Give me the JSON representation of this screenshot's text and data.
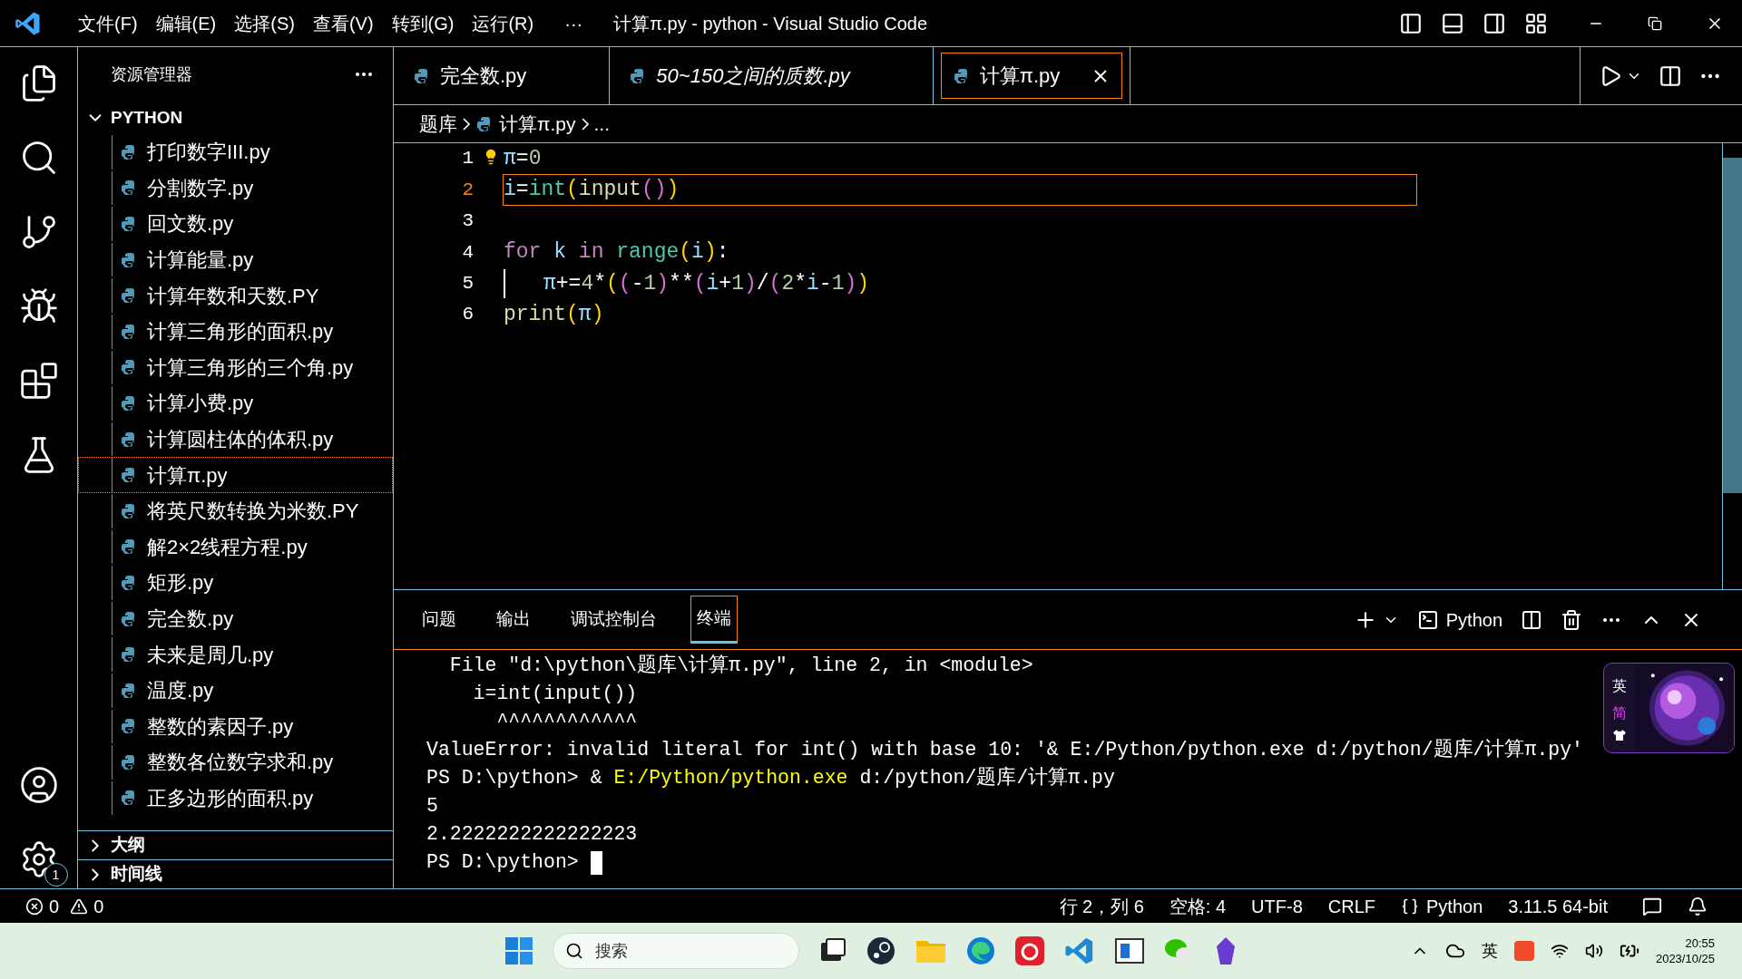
{
  "title_bar": {
    "menus": [
      "文件(F)",
      "编辑(E)",
      "选择(S)",
      "查看(V)",
      "转到(G)",
      "运行(R)"
    ],
    "overflow": "···",
    "title": "计算π.py - python - Visual Studio Code"
  },
  "activity_bar": {
    "settings_badge": "1"
  },
  "sidebar": {
    "title": "资源管理器",
    "folder": {
      "name": "PYTHON",
      "expanded": true
    },
    "files": [
      {
        "name": "打印数字III.py",
        "selected": false
      },
      {
        "name": "分割数字.py",
        "selected": false
      },
      {
        "name": "回文数.py",
        "selected": false
      },
      {
        "name": "计算能量.py",
        "selected": false
      },
      {
        "name": "计算年数和天数.PY",
        "selected": false
      },
      {
        "name": "计算三角形的面积.py",
        "selected": false
      },
      {
        "name": "计算三角形的三个角.py",
        "selected": false
      },
      {
        "name": "计算小费.py",
        "selected": false
      },
      {
        "name": "计算圆柱体的体积.py",
        "selected": false
      },
      {
        "name": "计算π.py",
        "selected": true
      },
      {
        "name": "将英尺数转换为米数.PY",
        "selected": false
      },
      {
        "name": "解2×2线程方程.py",
        "selected": false
      },
      {
        "name": "矩形.py",
        "selected": false
      },
      {
        "name": "完全数.py",
        "selected": false
      },
      {
        "name": "未来是周几.py",
        "selected": false
      },
      {
        "name": "温度.py",
        "selected": false
      },
      {
        "name": "整数的素因子.py",
        "selected": false
      },
      {
        "name": "整数各位数字求和.py",
        "selected": false
      },
      {
        "name": "正多边形的面积.py",
        "selected": false
      }
    ],
    "sections": [
      {
        "name": "大纲",
        "expanded": false
      },
      {
        "name": "时间线",
        "expanded": false
      }
    ]
  },
  "tabs": [
    {
      "label": "完全数.py",
      "selected": false,
      "preview": false
    },
    {
      "label": "50~150之间的质数.py",
      "selected": false,
      "preview": true
    },
    {
      "label": "计算π.py",
      "selected": true,
      "preview": false
    }
  ],
  "breadcrumb": [
    "题库",
    "计算π.py",
    "..."
  ],
  "editor": {
    "lines": [
      {
        "number": "1",
        "current": false,
        "indented": false,
        "tokens": [
          {
            "text": "π",
            "kind": "var"
          },
          {
            "text": "=",
            "kind": "op"
          },
          {
            "text": "0",
            "kind": "num"
          }
        ]
      },
      {
        "number": "2",
        "current": true,
        "indented": false,
        "tokens": [
          {
            "text": "i",
            "kind": "var"
          },
          {
            "text": "=",
            "kind": "op"
          },
          {
            "text": "int",
            "kind": "class"
          },
          {
            "text": "(",
            "kind": "b1"
          },
          {
            "text": "input",
            "kind": "func"
          },
          {
            "text": "()",
            "kind": "b2"
          },
          {
            "text": ")",
            "kind": "b1"
          }
        ]
      },
      {
        "number": "3",
        "current": false,
        "indented": false
      },
      {
        "number": "4",
        "current": false,
        "indented": false,
        "tokens": [
          {
            "text": "for",
            "kind": "keyword"
          },
          {
            "text": " k ",
            "kind": "var"
          },
          {
            "text": "in",
            "kind": "keyword"
          },
          {
            "text": " range",
            "kind": "class"
          },
          {
            "text": "(",
            "kind": "b1"
          },
          {
            "text": "i",
            "kind": "var"
          },
          {
            "text": ")",
            "kind": "b1"
          },
          {
            "text": ":",
            "kind": "op"
          }
        ]
      },
      {
        "number": "5",
        "current": false,
        "indented": true,
        "tokens": [
          {
            "text": "π",
            "kind": "var"
          },
          {
            "text": "+=",
            "kind": "op"
          },
          {
            "text": "4",
            "kind": "num"
          },
          {
            "text": "*",
            "kind": "op"
          },
          {
            "text": "(",
            "kind": "b1"
          },
          {
            "text": "(",
            "kind": "b2"
          },
          {
            "text": "-",
            "kind": "op"
          },
          {
            "text": "1",
            "kind": "num"
          },
          {
            "text": ")",
            "kind": "b2"
          },
          {
            "text": "**",
            "kind": "op"
          },
          {
            "text": "(",
            "kind": "b2"
          },
          {
            "text": "i",
            "kind": "var"
          },
          {
            "text": "+",
            "kind": "op"
          },
          {
            "text": "1",
            "kind": "num"
          },
          {
            "text": ")",
            "kind": "b2"
          },
          {
            "text": "/",
            "kind": "op"
          },
          {
            "text": "(",
            "kind": "b2"
          },
          {
            "text": "2",
            "kind": "num"
          },
          {
            "text": "*",
            "kind": "op"
          },
          {
            "text": "i",
            "kind": "var"
          },
          {
            "text": "-",
            "kind": "op"
          },
          {
            "text": "1",
            "kind": "num"
          },
          {
            "text": ")",
            "kind": "b2"
          },
          {
            "text": ")",
            "kind": "b1"
          }
        ]
      },
      {
        "number": "6",
        "current": false,
        "indented": false,
        "tokens": [
          {
            "text": "print",
            "kind": "func"
          },
          {
            "text": "(",
            "kind": "b1"
          },
          {
            "text": "π",
            "kind": "var"
          },
          {
            "text": ")",
            "kind": "b1"
          }
        ]
      }
    ]
  },
  "panel": {
    "tabs": [
      {
        "label": "问题",
        "selected": false
      },
      {
        "label": "输出",
        "selected": false
      },
      {
        "label": "调试控制台",
        "selected": false
      },
      {
        "label": "终端",
        "selected": true
      }
    ],
    "terminal_profile": "Python",
    "terminal_lines": [
      [
        {
          "text": "  File \"d:\\python\\题库\\计算π.py\", line 2, in <module>",
          "kind": "plain"
        }
      ],
      [
        {
          "text": "    i=int(input())",
          "kind": "plain"
        }
      ],
      [
        {
          "text": "      ^^^^^^^^^^^^",
          "kind": "plain"
        }
      ],
      [
        {
          "text": "ValueError: invalid literal for int() with base 10: '& E:/Python/python.exe d:/python/题库/计算π.py'",
          "kind": "plain"
        }
      ],
      [
        {
          "text": "PS D:\\python> & ",
          "kind": "plain"
        },
        {
          "text": "E:/Python/python.exe",
          "kind": "path"
        },
        {
          "text": " d:/python/题库/计算π.py",
          "kind": "plain"
        }
      ],
      [
        {
          "text": "5",
          "kind": "plain"
        }
      ],
      [
        {
          "text": "2.2222222222222223",
          "kind": "plain"
        }
      ],
      [
        {
          "text": "PS D:\\python> ",
          "kind": "plain"
        }
      ]
    ],
    "ime_widget": {
      "labels": [
        "英",
        "简"
      ]
    }
  },
  "status_bar": {
    "errors": "0",
    "warnings": "0",
    "position": "行 2，列 6",
    "indent": "空格: 4",
    "encoding": "UTF-8",
    "eol": "CRLF",
    "language": "Python",
    "interpreter": "3.11.5 64-bit"
  },
  "taskbar": {
    "search_placeholder": "搜索",
    "tray_ime": "英",
    "time": "20:55",
    "date": "2023/10/25"
  }
}
